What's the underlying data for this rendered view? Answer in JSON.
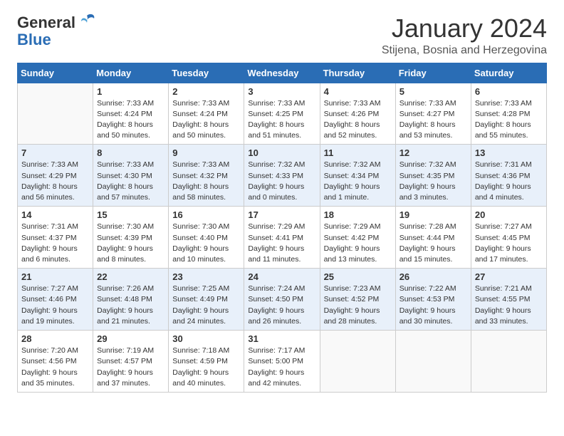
{
  "header": {
    "logo_general": "General",
    "logo_blue": "Blue",
    "month": "January 2024",
    "location": "Stijena, Bosnia and Herzegovina"
  },
  "days_of_week": [
    "Sunday",
    "Monday",
    "Tuesday",
    "Wednesday",
    "Thursday",
    "Friday",
    "Saturday"
  ],
  "weeks": [
    [
      {
        "day": "",
        "info": ""
      },
      {
        "day": "1",
        "info": "Sunrise: 7:33 AM\nSunset: 4:24 PM\nDaylight: 8 hours\nand 50 minutes."
      },
      {
        "day": "2",
        "info": "Sunrise: 7:33 AM\nSunset: 4:24 PM\nDaylight: 8 hours\nand 50 minutes."
      },
      {
        "day": "3",
        "info": "Sunrise: 7:33 AM\nSunset: 4:25 PM\nDaylight: 8 hours\nand 51 minutes."
      },
      {
        "day": "4",
        "info": "Sunrise: 7:33 AM\nSunset: 4:26 PM\nDaylight: 8 hours\nand 52 minutes."
      },
      {
        "day": "5",
        "info": "Sunrise: 7:33 AM\nSunset: 4:27 PM\nDaylight: 8 hours\nand 53 minutes."
      },
      {
        "day": "6",
        "info": "Sunrise: 7:33 AM\nSunset: 4:28 PM\nDaylight: 8 hours\nand 55 minutes."
      }
    ],
    [
      {
        "day": "7",
        "info": "Sunrise: 7:33 AM\nSunset: 4:29 PM\nDaylight: 8 hours\nand 56 minutes."
      },
      {
        "day": "8",
        "info": "Sunrise: 7:33 AM\nSunset: 4:30 PM\nDaylight: 8 hours\nand 57 minutes."
      },
      {
        "day": "9",
        "info": "Sunrise: 7:33 AM\nSunset: 4:32 PM\nDaylight: 8 hours\nand 58 minutes."
      },
      {
        "day": "10",
        "info": "Sunrise: 7:32 AM\nSunset: 4:33 PM\nDaylight: 9 hours\nand 0 minutes."
      },
      {
        "day": "11",
        "info": "Sunrise: 7:32 AM\nSunset: 4:34 PM\nDaylight: 9 hours\nand 1 minute."
      },
      {
        "day": "12",
        "info": "Sunrise: 7:32 AM\nSunset: 4:35 PM\nDaylight: 9 hours\nand 3 minutes."
      },
      {
        "day": "13",
        "info": "Sunrise: 7:31 AM\nSunset: 4:36 PM\nDaylight: 9 hours\nand 4 minutes."
      }
    ],
    [
      {
        "day": "14",
        "info": "Sunrise: 7:31 AM\nSunset: 4:37 PM\nDaylight: 9 hours\nand 6 minutes."
      },
      {
        "day": "15",
        "info": "Sunrise: 7:30 AM\nSunset: 4:39 PM\nDaylight: 9 hours\nand 8 minutes."
      },
      {
        "day": "16",
        "info": "Sunrise: 7:30 AM\nSunset: 4:40 PM\nDaylight: 9 hours\nand 10 minutes."
      },
      {
        "day": "17",
        "info": "Sunrise: 7:29 AM\nSunset: 4:41 PM\nDaylight: 9 hours\nand 11 minutes."
      },
      {
        "day": "18",
        "info": "Sunrise: 7:29 AM\nSunset: 4:42 PM\nDaylight: 9 hours\nand 13 minutes."
      },
      {
        "day": "19",
        "info": "Sunrise: 7:28 AM\nSunset: 4:44 PM\nDaylight: 9 hours\nand 15 minutes."
      },
      {
        "day": "20",
        "info": "Sunrise: 7:27 AM\nSunset: 4:45 PM\nDaylight: 9 hours\nand 17 minutes."
      }
    ],
    [
      {
        "day": "21",
        "info": "Sunrise: 7:27 AM\nSunset: 4:46 PM\nDaylight: 9 hours\nand 19 minutes."
      },
      {
        "day": "22",
        "info": "Sunrise: 7:26 AM\nSunset: 4:48 PM\nDaylight: 9 hours\nand 21 minutes."
      },
      {
        "day": "23",
        "info": "Sunrise: 7:25 AM\nSunset: 4:49 PM\nDaylight: 9 hours\nand 24 minutes."
      },
      {
        "day": "24",
        "info": "Sunrise: 7:24 AM\nSunset: 4:50 PM\nDaylight: 9 hours\nand 26 minutes."
      },
      {
        "day": "25",
        "info": "Sunrise: 7:23 AM\nSunset: 4:52 PM\nDaylight: 9 hours\nand 28 minutes."
      },
      {
        "day": "26",
        "info": "Sunrise: 7:22 AM\nSunset: 4:53 PM\nDaylight: 9 hours\nand 30 minutes."
      },
      {
        "day": "27",
        "info": "Sunrise: 7:21 AM\nSunset: 4:55 PM\nDaylight: 9 hours\nand 33 minutes."
      }
    ],
    [
      {
        "day": "28",
        "info": "Sunrise: 7:20 AM\nSunset: 4:56 PM\nDaylight: 9 hours\nand 35 minutes."
      },
      {
        "day": "29",
        "info": "Sunrise: 7:19 AM\nSunset: 4:57 PM\nDaylight: 9 hours\nand 37 minutes."
      },
      {
        "day": "30",
        "info": "Sunrise: 7:18 AM\nSunset: 4:59 PM\nDaylight: 9 hours\nand 40 minutes."
      },
      {
        "day": "31",
        "info": "Sunrise: 7:17 AM\nSunset: 5:00 PM\nDaylight: 9 hours\nand 42 minutes."
      },
      {
        "day": "",
        "info": ""
      },
      {
        "day": "",
        "info": ""
      },
      {
        "day": "",
        "info": ""
      }
    ]
  ]
}
